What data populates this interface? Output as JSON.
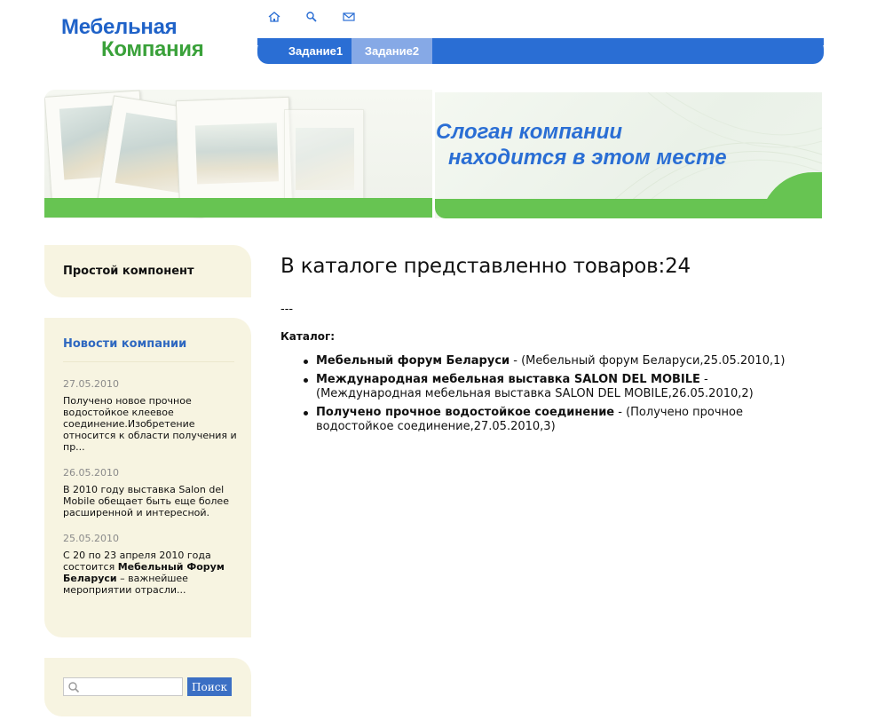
{
  "logo": {
    "line1": "Мебельная",
    "line2": "Компания"
  },
  "top_icons": [
    "home-icon",
    "search-icon",
    "mail-icon"
  ],
  "nav": {
    "tabs": [
      {
        "label": "Задание1"
      },
      {
        "label": "Задание2"
      }
    ]
  },
  "banner": {
    "slogan_line1": "Слоган компании",
    "slogan_line2": "находится в этом месте"
  },
  "sidebar": {
    "simple_component": {
      "title": "Простой компонент"
    },
    "news": {
      "title": "Новости компании",
      "items": [
        {
          "date": "27.05.2010",
          "text": "Получено новое прочное водостойкое клеевое соединение.Изобретение относится к области получения и пр..."
        },
        {
          "date": "26.05.2010",
          "text": "В 2010 году выставка Salon del Mobile обещает быть еще более расширенной и интересной."
        },
        {
          "date": "25.05.2010",
          "text_before": "С 20 по 23 апреля 2010 года состоится ",
          "text_bold": "Мебельный Форум Беларуси",
          "text_after": " – важнейшее мероприятии отрасли..."
        }
      ]
    },
    "search": {
      "placeholder": "",
      "button_label": "Поиск"
    }
  },
  "main": {
    "title": "В каталоге представленно товаров:24",
    "dashes": "---",
    "catalog_label": "Каталог:",
    "items": [
      {
        "name": "Мебельный форум Беларуси",
        "detail": " - (Мебельный форум Беларуси,25.05.2010,1)"
      },
      {
        "name": "Международная мебельная выставка SALON DEL MOBILE",
        "detail": " - (Международная мебельная выставка SALON DEL MOBILE,26.05.2010,2)"
      },
      {
        "name": "Получено прочное водостойкое соединение",
        "detail": " - (Получено прочное водостойкое соединение,27.05.2010,3)"
      }
    ]
  },
  "colors": {
    "brand_blue": "#2a6ed4",
    "brand_green": "#3aa13a",
    "banner_green": "#67c452",
    "sidebar_bg": "#f7f4e1",
    "active_tab": "#86a9e6"
  }
}
